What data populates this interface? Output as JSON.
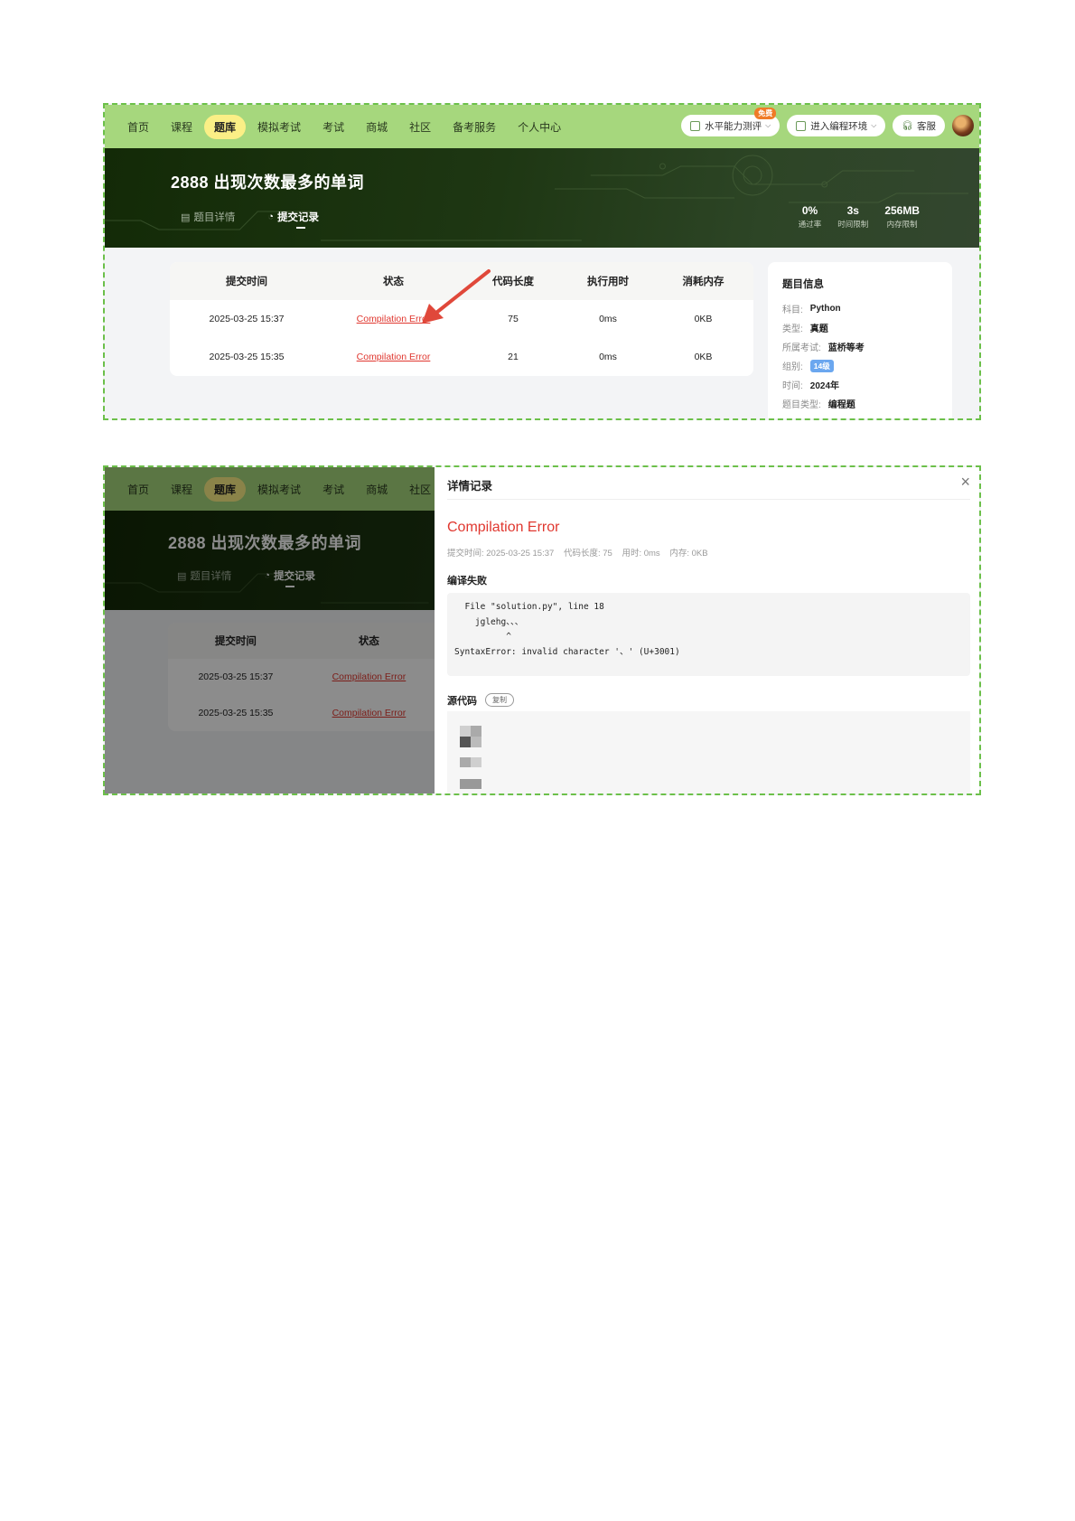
{
  "nav": {
    "items": [
      "首页",
      "课程",
      "题库",
      "模拟考试",
      "考试",
      "商城",
      "社区",
      "备考服务",
      "个人中心"
    ],
    "active": "题库",
    "ability_test": "水平能力测评",
    "free_badge": "免费",
    "coding_env": "进入编程环境",
    "service": "客服",
    "chevron": "chevron-down-icon"
  },
  "nav_dim": {
    "items": [
      "首页",
      "课程",
      "题库",
      "模拟考试",
      "考试",
      "商城",
      "社区"
    ]
  },
  "problem": {
    "title": "2888  出现次数最多的单词",
    "tab_detail": "题目详情",
    "tab_submissions": "提交记录",
    "stats": [
      {
        "value": "0%",
        "label": "通过率"
      },
      {
        "value": "3s",
        "label": "时间限制"
      },
      {
        "value": "256MB",
        "label": "内存限制"
      }
    ]
  },
  "table": {
    "headers": [
      "提交时间",
      "状态",
      "代码长度",
      "执行用时",
      "消耗内存"
    ],
    "rows": [
      {
        "time": "2025-03-25 15:37",
        "status": "Compilation Error",
        "length": "75",
        "runtime": "0ms",
        "memory": "0KB"
      },
      {
        "time": "2025-03-25 15:35",
        "status": "Compilation Error",
        "length": "21",
        "runtime": "0ms",
        "memory": "0KB"
      }
    ]
  },
  "info": {
    "title": "题目信息",
    "rows": [
      {
        "key": "科目:",
        "value": "Python"
      },
      {
        "key": "类型:",
        "value": "真题"
      },
      {
        "key": "所属考试:",
        "value": "蓝桥等考"
      },
      {
        "key": "组别:",
        "value": "14级"
      },
      {
        "key": "时间:",
        "value": "2024年"
      },
      {
        "key": "题目类型:",
        "value": "编程题"
      }
    ]
  },
  "detail": {
    "title": "详情记录",
    "status": "Compilation Error",
    "meta": [
      "提交时间: 2025-03-25 15:37",
      "代码长度: 75",
      "用时: 0ms",
      "内存: 0KB"
    ],
    "compile_label": "编译失败",
    "compile_output": [
      "  File \"solution.py\", line 18",
      "    jglehg、、、",
      "          ^",
      "SyntaxError: invalid character '、' (U+3001)"
    ],
    "source_label": "源代码",
    "copy_label": "复制"
  },
  "colors": {
    "accent": "#a6d77d",
    "nav_active": "#fbef86",
    "error": "#e0372f",
    "hero": "#1e3713",
    "shot_border": "#6cc04a"
  }
}
